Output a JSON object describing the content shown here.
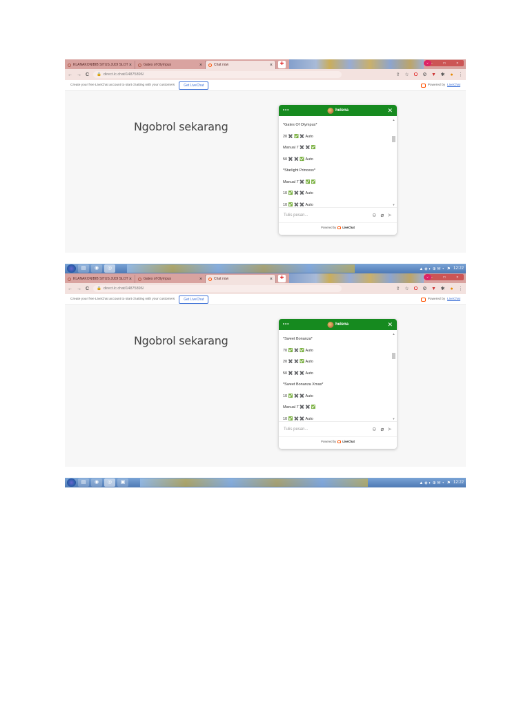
{
  "tabs": [
    {
      "label": "KLANAKONIBIB SITUS JUDI SLOT",
      "active": false
    },
    {
      "label": "Gates of Olympus",
      "active": false
    },
    {
      "label": "Chat now",
      "active": true
    }
  ],
  "address": {
    "url": "direct.lc.chat/14875896/"
  },
  "livechat_bar": {
    "promo": "Create your free LiveChat account to start chatting with your customers",
    "button": "Get LiveChat",
    "powered_prefix": "Powered by",
    "powered_link": "LiveChat"
  },
  "page": {
    "headline": "Ngobrol sekarang"
  },
  "widget": {
    "agent_name": "helena",
    "input_placeholder": "Tulis pesan...",
    "footer_prefix": "Powered by",
    "footer_brand": "LiveChat"
  },
  "screens": [
    {
      "messages": [
        "*Gates Of Olympus*",
        "20 ✖️ ✅ ✖️ Auto",
        "Manual 7 ✖️ ✖️ ✅",
        "50 ✖️ ✖️ ✅ Auto",
        "*Starlight Princess*",
        "Manual 7 ✖️ ✅ ✅",
        "10 ✅ ✖️ ✖️ Auto",
        "10 ✅ ✖️ ✖️ Auto"
      ]
    },
    {
      "messages": [
        "*Sweet Bonanza*",
        "70 ✅ ✖️ ✅ Auto",
        "20 ✖️ ✖️ ✅ Auto",
        "50 ✖️ ✖️ ✖️ Auto",
        "*Sweet Bonanza Xmas*",
        "10 ✅ ✖️ ✖️ Auto",
        "Manual 7 ✖️ ✖️ ✅",
        "10 ✅ ✖️ ✖️ Auto"
      ]
    }
  ],
  "taskbar": {
    "clock": "12:22"
  },
  "colors": {
    "widget_header": "#168a1f",
    "tabstrip": "#d9a3a0",
    "livechat_orange": "#ff5100"
  },
  "icons": [
    "back-icon",
    "forward-icon",
    "reload-icon",
    "lock-icon",
    "star-icon",
    "close-icon",
    "emoji-icon",
    "attach-icon",
    "send-icon",
    "menu-dots-icon",
    "windows-start-icon"
  ]
}
